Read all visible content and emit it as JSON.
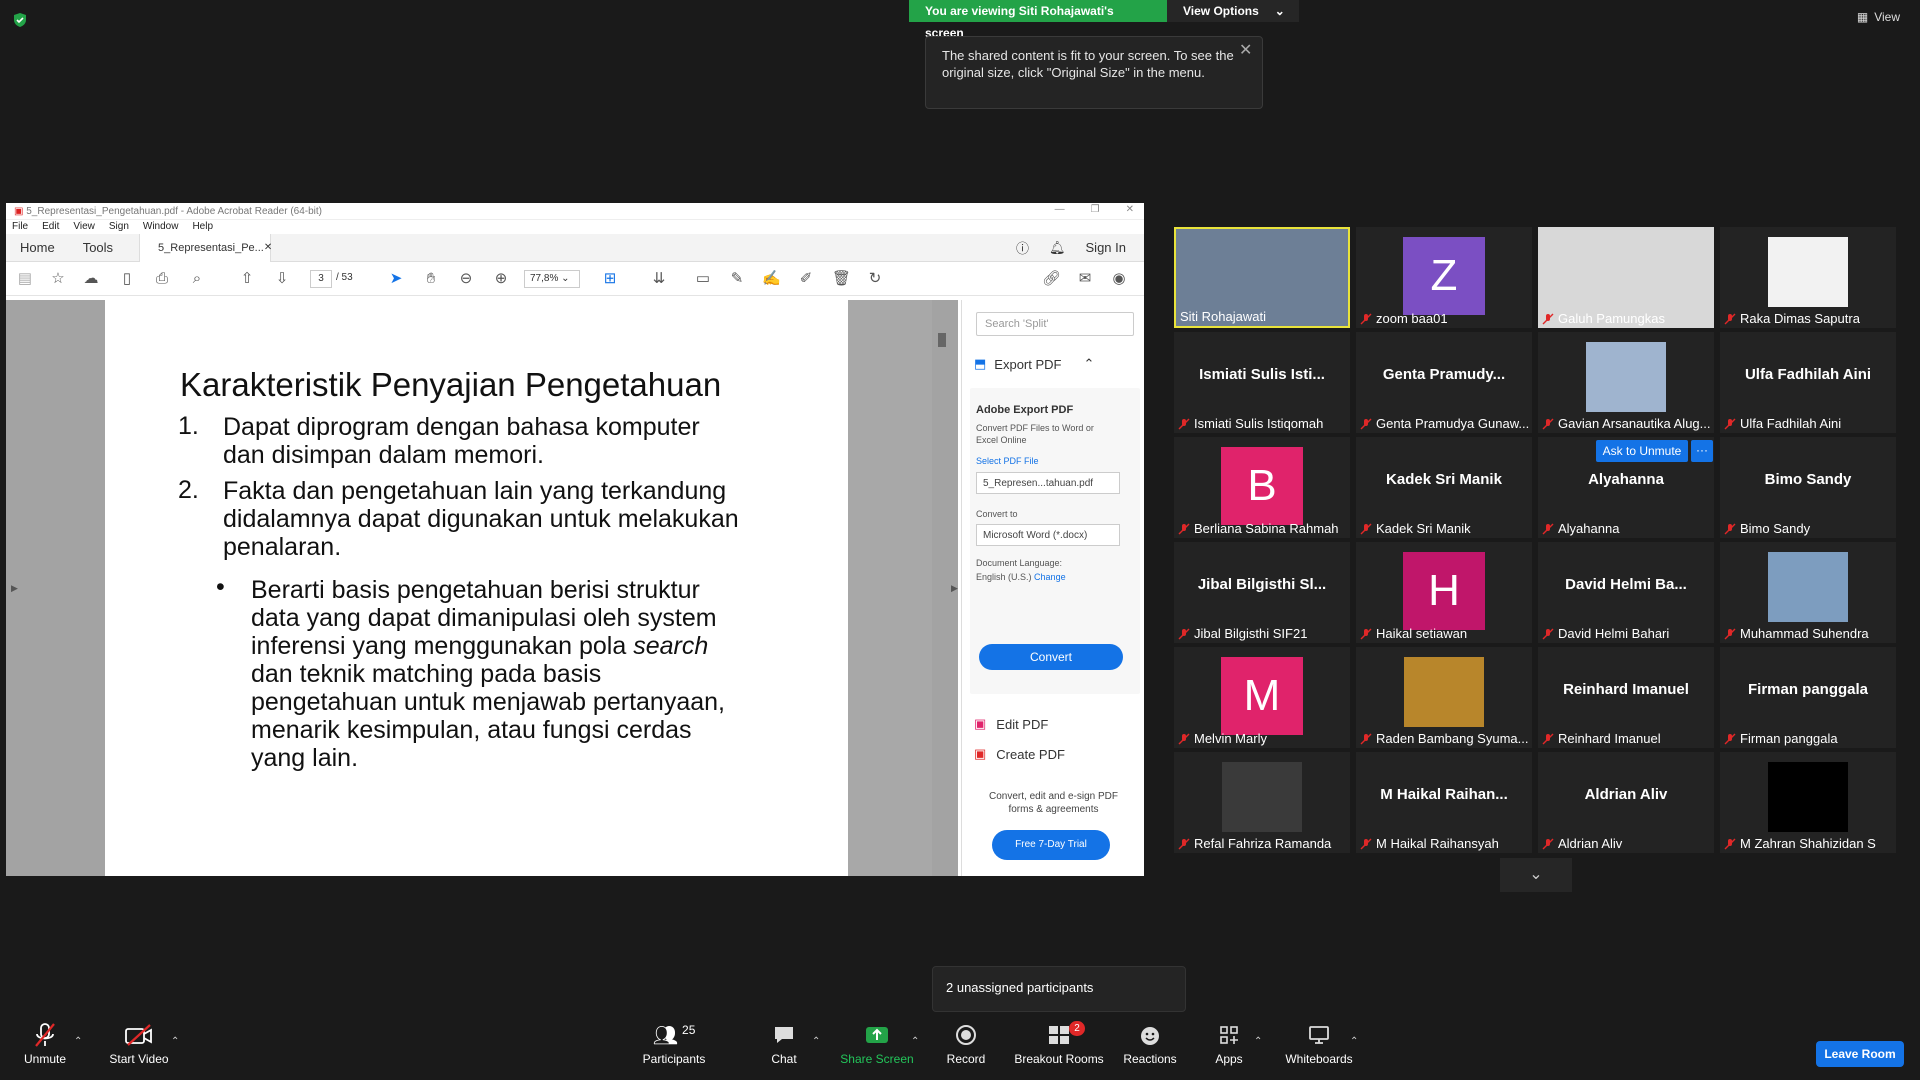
{
  "banner": {
    "viewing": "You are viewing Siti Rohajawati's screen",
    "view_options": "View Options"
  },
  "view_label": "View",
  "tooltip": {
    "text": "The shared content is fit to your screen. To see the original size, click \"Original Size\" in the menu."
  },
  "acrobat": {
    "title": "5_Representasi_Pengetahuan.pdf - Adobe Acrobat Reader (64-bit)",
    "menu": [
      "File",
      "Edit",
      "View",
      "Sign",
      "Window",
      "Help"
    ],
    "tabs": {
      "home": "Home",
      "tools": "Tools",
      "doc": "5_Representasi_Pe...",
      "sign_in": "Sign In"
    },
    "page_current": "3",
    "page_total": "/ 53",
    "zoom": "77,8%",
    "slide": {
      "title": "Karakteristik Penyajian Pengetahuan",
      "n1": "1.",
      "p1a": "Dapat diprogram dengan bahasa komputer",
      "p1b": "dan disimpan dalam memori.",
      "n2": "2.",
      "p2a": "Fakta dan pengetahuan lain yang terkandung",
      "p2b": "didalamnya dapat digunakan untuk melakukan",
      "p2c": "penalaran.",
      "bullet": "•",
      "b1": "Berarti basis pengetahuan berisi struktur",
      "b2": "data yang dapat dimanipulasi oleh system",
      "b3a": "inferensi yang menggunakan pola ",
      "b3b": "search",
      "b4": "dan teknik matching pada basis",
      "b5": "pengetahuan untuk menjawab pertanyaan,",
      "b6": "menarik kesimpulan, atau fungsi cerdas",
      "b7": "yang lain."
    },
    "panel": {
      "search": "Search 'Split'",
      "export_pdf": "Export PDF",
      "adobe_export": "Adobe Export PDF",
      "desc": "Convert PDF Files to Word or Excel Online",
      "select_file": "Select PDF File",
      "file": "5_Represen...tahuan.pdf",
      "convert_to": "Convert to",
      "format": "Microsoft Word (*.docx)",
      "doc_lang": "Document Language:",
      "lang": "English (U.S.)",
      "change": "Change",
      "convert": "Convert",
      "edit_pdf": "Edit PDF",
      "create_pdf": "Create PDF",
      "footer": "Convert, edit and e-sign PDF forms & agreements",
      "trial": "Free 7-Day Trial"
    }
  },
  "participants": [
    {
      "label": "Siti Rohajawati",
      "center": ""
    },
    {
      "label": "zoom baa01",
      "center": "",
      "avatar": "Z"
    },
    {
      "label": "Galuh Pamungkas",
      "center": ""
    },
    {
      "label": "Raka Dimas Saputra",
      "center": ""
    },
    {
      "label": "Ismiati Sulis Istiqomah",
      "center": "Ismiati Sulis Isti..."
    },
    {
      "label": "Genta Pramudya Gunaw...",
      "center": "Genta Pramudy..."
    },
    {
      "label": "Gavian Arsanautika Alug...",
      "center": ""
    },
    {
      "label": "Ulfa Fadhilah Aini",
      "center": "Ulfa Fadhilah Aini"
    },
    {
      "label": "Berliana Sabina Rahmah",
      "center": "",
      "avatar": "B"
    },
    {
      "label": "Kadek Sri Manik",
      "center": "Kadek Sri Manik"
    },
    {
      "label": "Alyahanna",
      "center": "Alyahanna"
    },
    {
      "label": "Bimo Sandy",
      "center": "Bimo Sandy"
    },
    {
      "label": "Jibal Bilgisthi SIF21",
      "center": "Jibal Bilgisthi Sl..."
    },
    {
      "label": "Haikal setiawan",
      "center": "",
      "avatar": "H"
    },
    {
      "label": "David Helmi Bahari",
      "center": "David Helmi Ba..."
    },
    {
      "label": "Muhammad Suhendra",
      "center": ""
    },
    {
      "label": "Melvin Marly",
      "center": "",
      "avatar": "M"
    },
    {
      "label": "Raden Bambang Syuma...",
      "center": ""
    },
    {
      "label": "Reinhard Imanuel",
      "center": "Reinhard Imanuel"
    },
    {
      "label": "Firman panggala",
      "center": "Firman panggala"
    },
    {
      "label": "Refal Fahriza Ramanda",
      "center": ""
    },
    {
      "label": "M Haikal Raihansyah",
      "center": "M Haikal Raihan..."
    },
    {
      "label": "Aldrian Aliv",
      "center": "Aldrian Aliv"
    },
    {
      "label": "M Zahran Shahizidan S",
      "center": ""
    }
  ],
  "ask_unmute": "Ask to Unmute",
  "more_dots": "···",
  "unassigned": "2 unassigned participants",
  "toolbar": {
    "unmute": "Unmute",
    "start_video": "Start Video",
    "participants": "Participants",
    "participants_count": "25",
    "chat": "Chat",
    "share_screen": "Share Screen",
    "record": "Record",
    "breakout": "Breakout Rooms",
    "breakout_badge": "2",
    "reactions": "Reactions",
    "apps": "Apps",
    "whiteboards": "Whiteboards",
    "leave": "Leave Room"
  },
  "colors": {
    "green": "#23a348",
    "blue": "#1473e6",
    "purple": "#7b4fc3",
    "pink": "#e0236b",
    "magenta": "#c0166a",
    "red_mic": "#e02828"
  }
}
